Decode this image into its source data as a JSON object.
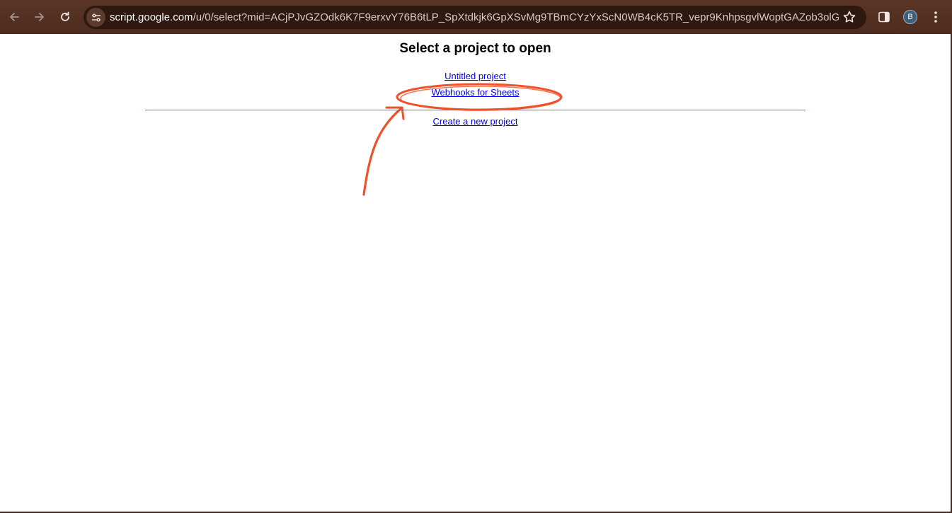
{
  "browser": {
    "url_host": "script.google.com",
    "url_path": "/u/0/select?mid=ACjPJvGZOdk6K7F9erxvY76B6tLP_SpXtdkjk6GpXSvMg9TBmCYzYxScN0WB4cK5TR_vepr9KnhpsgvlWoptGAZob3olG...",
    "profile_initial": "B",
    "colors": {
      "frame": "#4a2a1e",
      "omnibox": "#2e1810"
    },
    "icons": [
      "back-arrow-icon",
      "forward-arrow-icon",
      "reload-icon",
      "site-info-icon",
      "bookmark-star-icon",
      "side-panel-icon",
      "kebab-menu-icon"
    ]
  },
  "page": {
    "title": "Select a project to open",
    "projects": [
      {
        "label": "Untitled project"
      },
      {
        "label": "Webhooks for Sheets"
      }
    ],
    "create_label": "Create a new project",
    "link_color": "#0000ee",
    "annotation_color": "#f0502a"
  }
}
